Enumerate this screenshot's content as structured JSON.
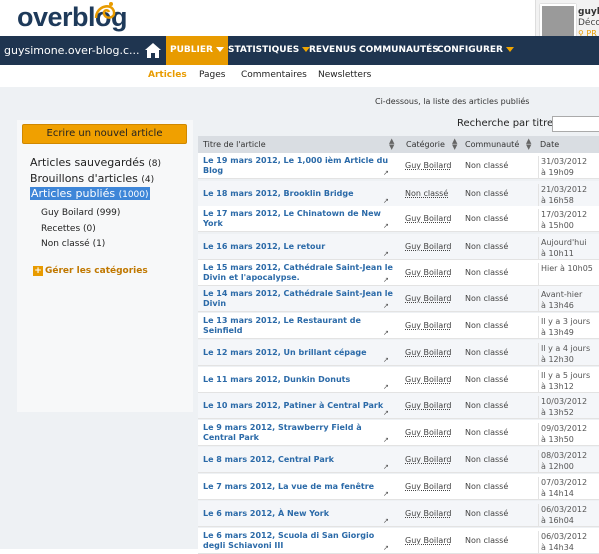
{
  "app": {
    "logo": "overblog"
  },
  "user": {
    "name": "guybo",
    "deco": "Déco",
    "pr": "PR"
  },
  "nav": {
    "site": "guysimone.over-blog.c...",
    "items": [
      "PUBLIER",
      "STATISTIQUES",
      "REVENUS",
      "COMMUNAUTÉS",
      "CONFIGURER"
    ]
  },
  "subnav": [
    "Articles",
    "Pages",
    "Commentaires",
    "Newsletters"
  ],
  "sidebar": {
    "new_article": "Ecrire un nouvel article",
    "groups": [
      {
        "label": "Articles sauvegardés",
        "count": "(8)"
      },
      {
        "label": "Brouillons d'articles",
        "count": "(4)"
      },
      {
        "label": "Articles publiés",
        "count": "(1000)"
      }
    ],
    "categories": [
      {
        "label": "Guy Boilard",
        "count": "(999)"
      },
      {
        "label": "Recettes",
        "count": "(0)"
      },
      {
        "label": "Non classé",
        "count": "(1)"
      }
    ],
    "manage": "Gérer les catégories"
  },
  "main": {
    "info": "Ci-dessous, la liste des articles publiés",
    "search_label": "Recherche par titre :",
    "search_value": "",
    "columns": [
      "Titre de l'article",
      "Catégorie",
      "Communauté",
      "Date"
    ],
    "rows": [
      {
        "title": "Le 19 mars 2012, Le 1,000 ièm Article du Blog",
        "category": "Guy Boilard",
        "community": "Non classé",
        "date1": "31/03/2012",
        "date2": "à 19h09"
      },
      {
        "title": "Le 18 mars 2012, Brooklin Bridge",
        "category": "Non classé",
        "community": "Non classé",
        "date1": "21/03/2012",
        "date2": "à 16h58"
      },
      {
        "title": "Le 17 mars 2012, Le Chinatown de New York",
        "category": "Guy Boilard",
        "community": "Non classé",
        "date1": "17/03/2012",
        "date2": "à 15h00"
      },
      {
        "title": "Le 16 mars 2012, Le retour",
        "category": "Guy Boilard",
        "community": "Non classé",
        "date1": "Aujourd'hui",
        "date2": "à 10h11"
      },
      {
        "title": "Le 15 mars 2012, Cathédrale Saint-Jean le Divin et l'apocalypse.",
        "category": "Guy Boilard",
        "community": "Non classé",
        "date1": "Hier à 10h05",
        "date2": ""
      },
      {
        "title": "Le 14 mars 2012, Cathédrale Saint-Jean le Divin",
        "category": "Guy Boilard",
        "community": "Non classé",
        "date1": "Avant-hier",
        "date2": "à 13h46"
      },
      {
        "title": "Le 13 mars 2012, Le Restaurant de Seinfield",
        "category": "Guy Boilard",
        "community": "Non classé",
        "date1": "Il y a 3 jours",
        "date2": "à 13h49"
      },
      {
        "title": "Le 12 mars 2012, Un brillant cépage",
        "category": "Guy Boilard",
        "community": "Non classé",
        "date1": "Il y a 4 jours",
        "date2": "à 12h30"
      },
      {
        "title": "Le 11 mars 2012, Dunkin Donuts",
        "category": "Guy Boilard",
        "community": "Non classé",
        "date1": "Il y a 5 jours",
        "date2": "à 13h12"
      },
      {
        "title": "Le 10 mars 2012, Patiner à Central Park",
        "category": "Guy Boilard",
        "community": "Non classé",
        "date1": "10/03/2012",
        "date2": "à 13h52"
      },
      {
        "title": "Le 9 mars 2012, Strawberry Field à Central Park",
        "category": "Guy Boilard",
        "community": "Non classé",
        "date1": "09/03/2012",
        "date2": "à 13h50"
      },
      {
        "title": "Le 8 mars 2012, Central Park",
        "category": "Guy Boilard",
        "community": "Non classé",
        "date1": "08/03/2012",
        "date2": "à 12h00"
      },
      {
        "title": "Le 7 mars 2012, La vue de ma fenêtre",
        "category": "Guy Boilard",
        "community": "Non classé",
        "date1": "07/03/2012",
        "date2": "à 14h14"
      },
      {
        "title": "Le 6 mars 2012, À New York",
        "category": "Guy Boilard",
        "community": "Non classé",
        "date1": "06/03/2012",
        "date2": "à 16h04"
      },
      {
        "title": "Le 6 mars 2012, Scuola di San Giorgio degli Schiavoni III",
        "category": "Guy Boilard",
        "community": "Non classé",
        "date1": "06/03/2012",
        "date2": "à 14h34"
      }
    ]
  },
  "colors": {
    "navbar": "#1f3550",
    "accent": "#e89b00",
    "link": "#2b6aa8"
  }
}
